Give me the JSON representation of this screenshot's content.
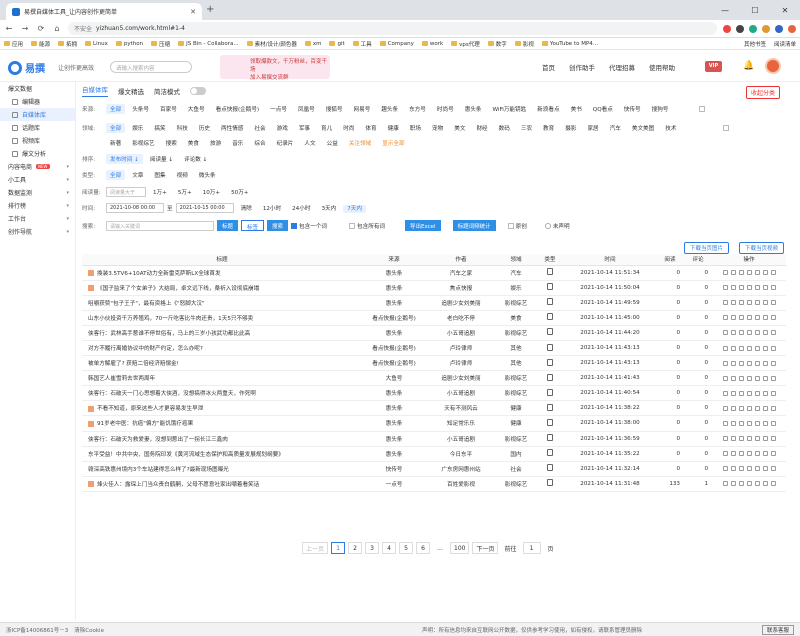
{
  "browser": {
    "tab_title": "易撰自媒体工具_让内容创作更简单",
    "security": "不安全",
    "url": "yizhuan5.com/work.html#1-4",
    "close_glyph": "✕",
    "new_tab_glyph": "+",
    "win_min": "—",
    "win_max": "☐",
    "win_close": "✕",
    "back": "←",
    "forward": "→",
    "reload": "⟳",
    "home": "⌂"
  },
  "bookmarks": {
    "items": [
      "应用",
      "能源",
      "拓拥",
      "Linux",
      "python",
      "压缩",
      "JS Bin - Collabora...",
      "素材/设计/颜色器",
      "xm",
      "git",
      "工具",
      "Company",
      "work",
      "vps代理",
      "数字",
      "影视",
      "YouTube to MP4..."
    ],
    "more": "其他书签",
    "reading": "阅读清单"
  },
  "topnav": {
    "logo_text": "易撰",
    "slogan": "让创作更高效",
    "search_placeholder": "请输入搜索内容",
    "banner_line1": "领取爆款文，千万粉丝，百变千场",
    "banner_line2": "加入易撰交流群",
    "menu": [
      "首页",
      "创作助手",
      "代理招募",
      "使用帮助"
    ],
    "vip": "VIP",
    "bell": "🔔"
  },
  "sidebar": {
    "items": [
      {
        "label": "爆文数据",
        "type": "group"
      },
      {
        "label": "编辑器",
        "type": "sub"
      },
      {
        "label": "自媒体库",
        "type": "sub",
        "active": true
      },
      {
        "label": "话题库",
        "type": "sub"
      },
      {
        "label": "视频库",
        "type": "sub"
      },
      {
        "label": "爆文分析",
        "type": "sub"
      },
      {
        "label": "内容电商",
        "type": "group",
        "badge": "NEW"
      },
      {
        "label": "小工具",
        "type": "group"
      },
      {
        "label": "数据监测",
        "type": "group"
      },
      {
        "label": "排行榜",
        "type": "group"
      },
      {
        "label": "工作台",
        "type": "group"
      },
      {
        "label": "创作导航",
        "type": "group"
      }
    ]
  },
  "main": {
    "mode_tabs": [
      "自媒体库",
      "爆文精选"
    ],
    "simple_mode": "简洁模式",
    "collapse": "收起分类",
    "source_label": "来源:",
    "sources": [
      "全部",
      "头条号",
      "百家号",
      "大鱼号",
      "看点快报(企鹅号)",
      "一点号",
      "凤凰号",
      "搜狐号",
      "网易号",
      "趣头条",
      "东方号",
      "时尚号",
      "惠头条",
      "WiFi万能钥匙",
      "新浪看点",
      "美书",
      "QQ看点",
      "快传号",
      "搜狗号"
    ],
    "field_label": "领域:",
    "fields_row1": [
      "全部",
      "娱乐",
      "搞笑",
      "科技",
      "历史",
      "两性情感",
      "社会",
      "游戏",
      "军事",
      "育儿",
      "时尚",
      "体育",
      "健康",
      "职场",
      "宠物",
      "美文",
      "财经",
      "数码",
      "三农",
      "教育",
      "摄影",
      "家居",
      "汽车",
      "美文美图",
      "技术"
    ],
    "fields_row2": [
      "新著",
      "影视综艺",
      "搜索",
      "美食",
      "旅游",
      "音乐",
      "综合",
      "纪录片",
      "人文",
      "公益"
    ],
    "follow_field": "关注领域",
    "show_all": "显示全部",
    "sort_label": "排序:",
    "sorts": [
      "发布时间 ↓",
      "阅读量 ↓",
      "评论数 ↓"
    ],
    "type_label": "类型:",
    "types": [
      "全部",
      "文章",
      "图集",
      "视频",
      "微头条"
    ],
    "reads_label": "阅读量:",
    "reads_placeholder": "阅读量大于",
    "reads": [
      "1万+",
      "5万+",
      "10万+",
      "50万+"
    ],
    "time_label": "时间:",
    "time_from": "2021-10-08 00:00",
    "time_to": "2021-10-15 00:00",
    "time_sep": "至",
    "times": [
      "清除",
      "12小时",
      "24小时",
      "3天内",
      "7天内"
    ],
    "search_label": "搜索:",
    "search_placeholder": "请输入关键词",
    "search_btns": [
      "标题",
      "标签",
      "搜索"
    ],
    "include_one": "包含一个词",
    "include_all": "包含所有词",
    "export_excel": "导出Excel",
    "title_stats": "标题词频统计",
    "original": "原创",
    "unsigned": "未声明",
    "dl_img": "下载当页图片",
    "dl_video": "下载当页视频"
  },
  "table": {
    "headers": [
      "标题",
      "来源",
      "作者",
      "领域",
      "类型",
      "时间",
      "阅读",
      "评论",
      "操作"
    ],
    "rows": [
      {
        "title": "換装3.5TV6+10AT动力全新雷克萨斯LX全球首发",
        "source": "惠头条",
        "author": "汽车之家",
        "field": "汽车",
        "time": "2021-10-14 11:51:34",
        "reads": "0",
        "comments": "0",
        "icon": true
      },
      {
        "title": "《国子监来了个女弟子》大结局，卓文远下线，桑祈入设彻底崩塌",
        "source": "惠头条",
        "author": "焦点快报",
        "field": "娱乐",
        "time": "2021-10-14 11:50:04",
        "reads": "0",
        "comments": "0",
        "icon": true
      },
      {
        "title": "咀嚼获赞\"包子王子\"，最有资格上《\"怒脚大汉\"",
        "source": "惠头条",
        "author": "追剧少女刘美丽",
        "field": "影视综艺",
        "time": "2021-10-14 11:49:59",
        "reads": "0",
        "comments": "0",
        "icon": false
      },
      {
        "title": "山东小伙投资千万养殖鸡，70一斤吃客比牛肉还贵，1天5只不够卖",
        "source": "看点快报(企鹅号)",
        "author": "老白吃不停",
        "field": "美食",
        "time": "2021-10-14 11:45:00",
        "reads": "0",
        "comments": "0",
        "icon": false
      },
      {
        "title": "侠客行：武林高手惹谁不停世俗有，马上的三岁小孩武功都比此高",
        "source": "惠头条",
        "author": "小五哥追剧",
        "field": "影视综艺",
        "time": "2021-10-14 11:44:20",
        "reads": "0",
        "comments": "0",
        "icon": false
      },
      {
        "title": "对方不履行离婚协议中的财产约定，怎么办呢?",
        "source": "看点快报(企鹅号)",
        "author": "卢玲律师",
        "field": "其他",
        "time": "2021-10-14 11:43:13",
        "reads": "0",
        "comments": "0",
        "icon": false
      },
      {
        "title": "被单方解雇了? 获赔二倍经济赔偿金!",
        "source": "看点快报(企鹅号)",
        "author": "卢玲律师",
        "field": "其他",
        "time": "2021-10-14 11:43:13",
        "reads": "0",
        "comments": "0",
        "icon": false
      },
      {
        "title": "韩国艺人崔雪莉去世两周年",
        "source": "大鱼号",
        "author": "追剧少女刘美丽",
        "field": "影视综艺",
        "time": "2021-10-14 11:41:43",
        "reads": "0",
        "comments": "0",
        "icon": false
      },
      {
        "title": "侠客行：石破天一门心思想着大侠酒，没想搞得冰火两重天，作死啊",
        "source": "惠头条",
        "author": "小五哥追剧",
        "field": "影视综艺",
        "time": "2021-10-14 11:40:54",
        "reads": "0",
        "comments": "0",
        "icon": false
      },
      {
        "title": "不看不知道，原来这些人才更容易发生早泄",
        "source": "惠头条",
        "author": "天有不测风云",
        "field": "健康",
        "time": "2021-10-14 11:38:22",
        "reads": "0",
        "comments": "0",
        "icon": true
      },
      {
        "title": "91岁老中医：抗癌\"偏方\"能饥饿疗癌果",
        "source": "惠头条",
        "author": "知足常乐乐",
        "field": "健康",
        "time": "2021-10-14 11:38:00",
        "reads": "0",
        "comments": "0",
        "icon": true
      },
      {
        "title": "侠客行：石破天为救爱妻，没想到惹出了一拐长江三鑫肉",
        "source": "惠头条",
        "author": "小五哥追剧",
        "field": "影视综艺",
        "time": "2021-10-14 11:36:59",
        "reads": "0",
        "comments": "0",
        "icon": false
      },
      {
        "title": "东平受益！中共中央、国务院印发《黄河流域生态保护和高质量发展规划纲要》",
        "source": "惠头条",
        "author": "今日东平",
        "field": "国内",
        "time": "2021-10-14 11:35:22",
        "reads": "0",
        "comments": "0",
        "icon": false
      },
      {
        "title": "赣深高铁惠州境内3个车站建得怎么样了?最新现场图曝光",
        "source": "快传号",
        "author": "广东房网惠州站",
        "field": "社会",
        "time": "2021-10-14 11:32:14",
        "reads": "0",
        "comments": "0",
        "icon": false
      },
      {
        "title": "烽火佳人：露琛上门当众责白鹤嗣，父母不愿意吐家出嘲着看笑话",
        "source": "一点号",
        "author": "百姓爱影视",
        "field": "影视综艺",
        "time": "2021-10-14 11:31:48",
        "reads": "133",
        "comments": "1",
        "icon": true
      }
    ]
  },
  "pager": {
    "prev": "上一页",
    "pages": [
      "1",
      "2",
      "3",
      "4",
      "5",
      "6",
      "...",
      "100"
    ],
    "next": "下一页",
    "goto": "前往",
    "goto_value": "1",
    "page_unit": "页"
  },
  "footer": {
    "icp": "浙ICP备14006861号－3",
    "clear_cookie": "清除Cookie",
    "disclaimer": "声明：所有信息均来自互联网公开数据，仅供参考学习使用，如有侵权，请联系管理员删除",
    "contact": "联系客服"
  }
}
